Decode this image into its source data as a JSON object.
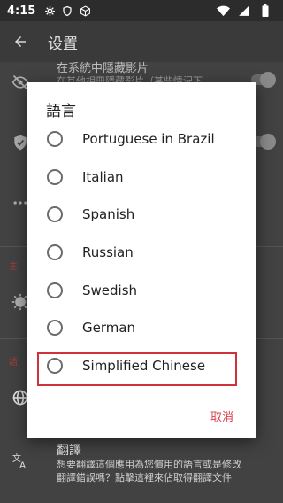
{
  "status_bar": {
    "time": "4:15"
  },
  "app_bar": {
    "title": "设置"
  },
  "background": {
    "rows": [
      {
        "title": "在系統中隱藏影片",
        "subtitle": "在其他相冊隱藏影片（某些情況下"
      },
      {
        "title": "",
        "subtitle": ""
      },
      {
        "title": "",
        "subtitle": ""
      }
    ],
    "section_theme": "主",
    "section_language": "語",
    "translate": {
      "title": "翻譯",
      "subtitle_line1": "想要翻譯這個應用為您慣用的語言或是修改",
      "subtitle_line2": "翻譯錯誤嗎？點擊這裡來佔取得翻譯文件"
    }
  },
  "dialog": {
    "title": "語言",
    "options": [
      {
        "label": "Portuguese in Brazil"
      },
      {
        "label": "Italian"
      },
      {
        "label": "Spanish"
      },
      {
        "label": "Russian"
      },
      {
        "label": "Swedish"
      },
      {
        "label": "German"
      },
      {
        "label": "Simplified Chinese"
      }
    ],
    "cancel_label": "取消"
  },
  "colors": {
    "accent": "#d9434d",
    "highlight": "#d0323d"
  }
}
